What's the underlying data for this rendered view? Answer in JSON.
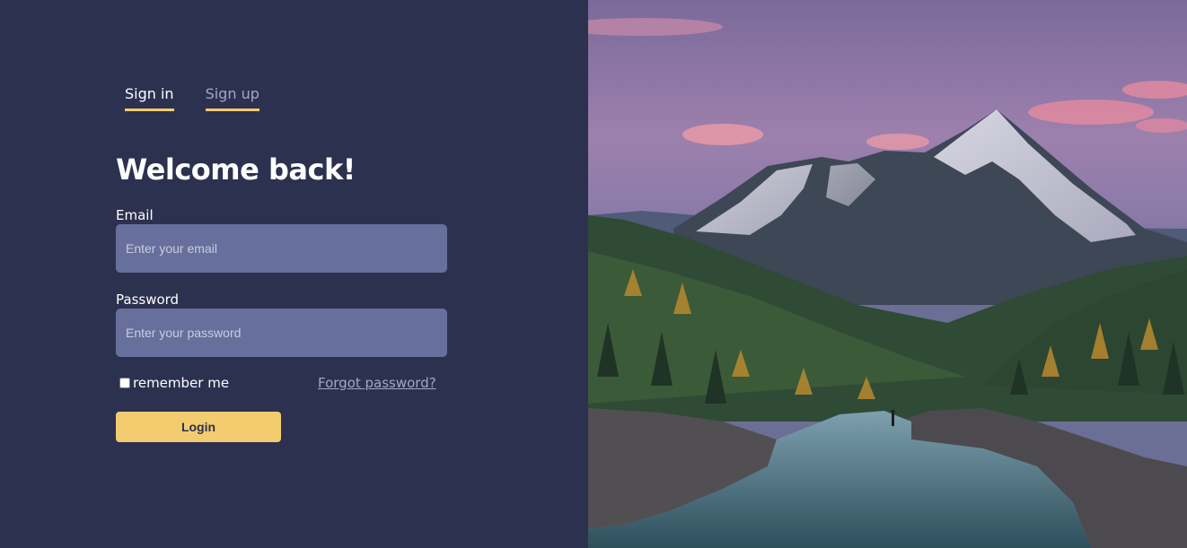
{
  "tabs": [
    {
      "label": "Sign in",
      "active": true
    },
    {
      "label": "Sign up",
      "active": false
    }
  ],
  "form": {
    "title": "Welcome back!",
    "email": {
      "label": "Email",
      "placeholder": "Enter your email",
      "value": ""
    },
    "password": {
      "label": "Password",
      "placeholder": "Enter your password",
      "value": ""
    },
    "remember_label": "remember me",
    "remember_checked": false,
    "forgot_label": "Forgot password?",
    "login_label": "Login"
  },
  "hero_image": {
    "subject": "mountain-landscape"
  },
  "colors": {
    "background": "#2d3150",
    "input_bg": "#67709c",
    "accent": "#f2cc6f",
    "muted_text": "#a3a7c2"
  }
}
